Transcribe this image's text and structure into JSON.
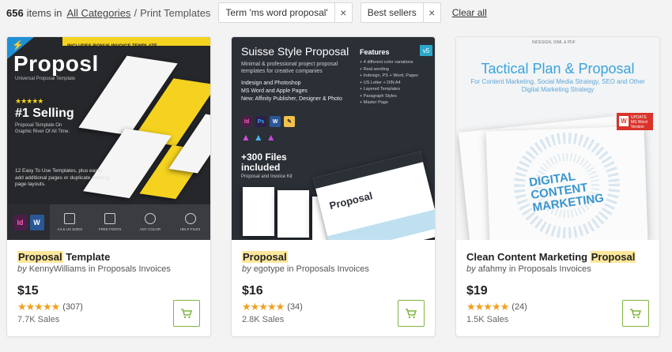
{
  "filter_bar": {
    "count": "656",
    "items_in": "items in",
    "category_link": "All Categories",
    "separator": "/",
    "current_category": "Print Templates",
    "chips": [
      {
        "label": "Term 'ms word proposal'"
      },
      {
        "label": "Best sellers"
      }
    ],
    "chip_close": "×",
    "clear_all": "Clear all"
  },
  "colors": {
    "accent_green": "#82b541",
    "star": "#f0a01e",
    "highlight": "#fde79b"
  },
  "products": [
    {
      "title_highlight": "Proposal",
      "title_rest": " Template",
      "by_prefix": "by",
      "author": "KennyWilliams",
      "in_text": "in",
      "category": "Proposals Invoices",
      "price": "$15",
      "stars": "★★★★★",
      "reviews": "(307)",
      "sales": "7.7K Sales",
      "thumb": {
        "banner": "INCLUDES BONUS INVOICE TEMPLATE",
        "brand": "Proposl",
        "subtitle": "Universal Proposal Template",
        "rank": "#1 Selling",
        "desc": "Proposal Template On Graphic River Of All Time.",
        "templates": "12 Easy To Use Templates, plus easily add additional pages or duplicate existing page layouts.",
        "app_label": "ADOBE INDESIGN MICROSOFT WORD",
        "features": [
          "A4 & US SIZES",
          "FREE FONTS",
          "ANY COLOR",
          "HELP FILES"
        ],
        "icon": "lightning-icon"
      }
    },
    {
      "title_highlight": "Proposal",
      "title_rest": "",
      "by_prefix": "by",
      "author": "egotype",
      "in_text": "in",
      "category": "Proposals Invoices",
      "price": "$16",
      "stars": "★★★★★",
      "reviews": "(34)",
      "sales": "2.8K Sales",
      "thumb": {
        "title": "Suisse Style Proposal",
        "version": "v5",
        "intro": "Minimal & professional project proposal templates for creative companies",
        "apps": [
          "Indesign and Photoshop",
          "MS Word and Apple Pages",
          "New: Affinity Publisher, Designer & Photo"
        ],
        "features_title": "Features",
        "features": [
          "+ 4 different color variations",
          "+ Real wording",
          "+ Indesign, PS + Word, Pages",
          "+ US Letter + DIN A4",
          "+ Layered Templates",
          "+ Paragraph Styles",
          "+ Master Page"
        ],
        "files": "+300 Files included",
        "kit": "Proposal and Invoice Kit",
        "doc_word": "Proposal"
      }
    },
    {
      "title_prefix": "Clean Content Marketing ",
      "title_highlight": "Proposal",
      "by_prefix": "by",
      "author": "afahmy",
      "in_text": "in",
      "category": "Proposals Invoices",
      "price": "$19",
      "stars": "★★★★★",
      "reviews": "(24)",
      "sales": "1.5K Sales",
      "thumb": {
        "tag": "INDESIGN, IDML & PDF",
        "title": "Tactical Plan & Proposal",
        "subtitle": "For Content Marketing, Social Media Strategy, SEO and Other Digital Marketing Strategy",
        "update": "UPDATE MS Word Version",
        "cover": "DIGITAL CONTENT MARKETING"
      }
    }
  ]
}
